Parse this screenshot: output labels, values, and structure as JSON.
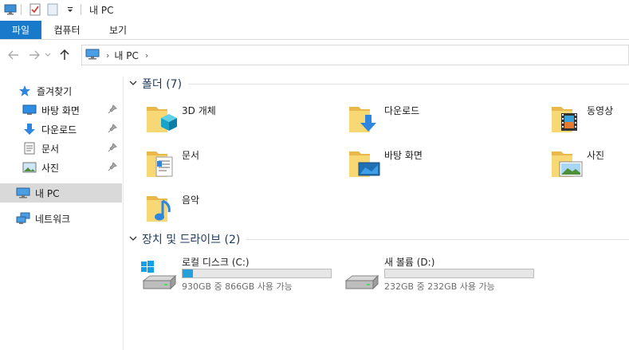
{
  "window": {
    "title": "내 PC"
  },
  "quick_access": {
    "icons": [
      "computer-icon",
      "properties-icon",
      "new-folder-icon",
      "customize-dropdown-icon"
    ]
  },
  "ribbon": {
    "tabs": [
      {
        "label": "파일"
      },
      {
        "label": "컴퓨터"
      },
      {
        "label": "보기"
      }
    ]
  },
  "address": {
    "location": "내 PC"
  },
  "sidebar": {
    "items": [
      {
        "label": "즐겨찾기",
        "icon": "star-icon"
      },
      {
        "label": "바탕 화면",
        "icon": "desktop-icon",
        "pinned": true
      },
      {
        "label": "다운로드",
        "icon": "download-icon",
        "pinned": true
      },
      {
        "label": "문서",
        "icon": "documents-icon",
        "pinned": true
      },
      {
        "label": "사진",
        "icon": "pictures-icon",
        "pinned": true
      },
      {
        "label": "내 PC",
        "icon": "computer-icon",
        "selected": true
      },
      {
        "label": "네트워크",
        "icon": "network-icon"
      }
    ]
  },
  "groups": {
    "folders": {
      "title": "폴더 (7)",
      "items": [
        {
          "label": "3D 개체",
          "icon": "3d-objects-icon"
        },
        {
          "label": "다운로드",
          "icon": "downloads-folder-icon"
        },
        {
          "label": "동영상",
          "icon": "videos-folder-icon"
        },
        {
          "label": "문서",
          "icon": "documents-folder-icon"
        },
        {
          "label": "바탕 화면",
          "icon": "desktop-folder-icon"
        },
        {
          "label": "사진",
          "icon": "pictures-folder-icon"
        },
        {
          "label": "음악",
          "icon": "music-folder-icon"
        }
      ]
    },
    "drives": {
      "title": "장치 및 드라이브 (2)",
      "items": [
        {
          "label": "로컬 디스크 (C:)",
          "info": "930GB 중 866GB 사용 가능",
          "used_fraction": 0.069,
          "icon": "windows-drive-icon"
        },
        {
          "label": "새 볼륨 (D:)",
          "info": "232GB 중 232GB 사용 가능",
          "used_fraction": 0.0,
          "icon": "drive-icon"
        }
      ]
    }
  },
  "colors": {
    "accent": "#1979ca",
    "folder": "#f8d775",
    "selection": "#d9d9d9",
    "bar_fill": "#26a0da",
    "group_title": "#1e395b"
  }
}
